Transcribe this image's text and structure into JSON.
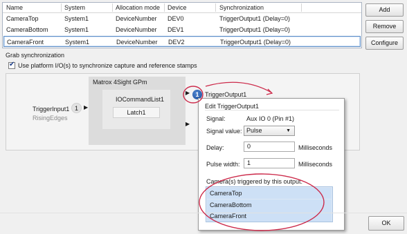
{
  "table": {
    "headers": [
      "Name",
      "System",
      "Allocation mode",
      "Device",
      "Synchronization"
    ],
    "rows": [
      [
        "CameraTop",
        "System1",
        "DeviceNumber",
        "DEV0",
        "TriggerOutput1 (Delay=0)"
      ],
      [
        "CameraBottom",
        "System1",
        "DeviceNumber",
        "DEV1",
        "TriggerOutput1 (Delay=0)"
      ],
      [
        "CameraFront",
        "System1",
        "DeviceNumber",
        "DEV2",
        "TriggerOutput1 (Delay=0)"
      ]
    ]
  },
  "buttons": {
    "add": "Add",
    "remove": "Remove",
    "configure": "Configure",
    "ok": "OK"
  },
  "grab": {
    "label": "Grab synchronization",
    "checkbox_label": "Use platform I/O(s) to synchronize capture and reference stamps",
    "checked": true
  },
  "diagram": {
    "system_label": "Matrox 4Sight GPm",
    "io_list_label": "IOCommandList1",
    "latch_label": "Latch1",
    "trigger_input": "TriggerInput1",
    "trigger_input_num": "1",
    "trigger_edge": "RisingEdges",
    "output_badge": "1",
    "output_label": "TriggerOutput1",
    "arrow_glyph": "▶"
  },
  "popup": {
    "title": "Edit TriggerOutput1",
    "signal_label": "Signal:",
    "signal_value": "Aux IO 0 (Pin #1)",
    "signal_value_label": "Signal value:",
    "signal_select": "Pulse",
    "delay_label": "Delay:",
    "delay_value": "0",
    "delay_unit": "Milliseconds",
    "pulse_label": "Pulse width:",
    "pulse_value": "1",
    "pulse_unit": "Milliseconds",
    "cameras_label": "Camera(s) triggered by this output:",
    "cameras": [
      "CameraTop",
      "CameraBottom",
      "CameraFront"
    ]
  },
  "colors": {
    "annotation": "#cc2a4a",
    "selection": "#cde0f6",
    "badge": "#1d4d99"
  }
}
